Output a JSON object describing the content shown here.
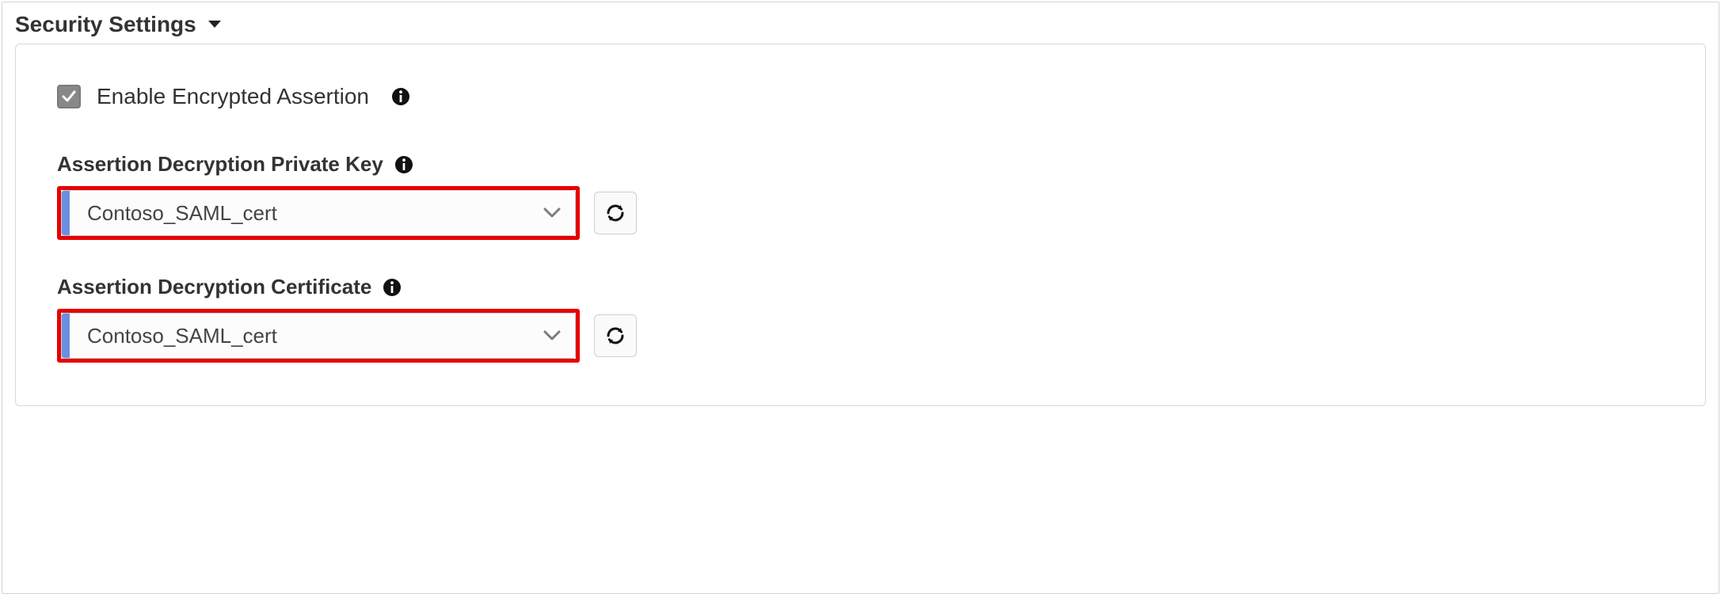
{
  "section": {
    "title": "Security Settings"
  },
  "checkbox": {
    "label": "Enable Encrypted Assertion",
    "checked": true
  },
  "fields": {
    "privateKey": {
      "label": "Assertion Decryption Private Key",
      "value": "Contoso_SAML_cert"
    },
    "certificate": {
      "label": "Assertion Decryption Certificate",
      "value": "Contoso_SAML_cert"
    }
  },
  "colors": {
    "highlight": "#e60000",
    "accent": "#6b8fe0"
  }
}
